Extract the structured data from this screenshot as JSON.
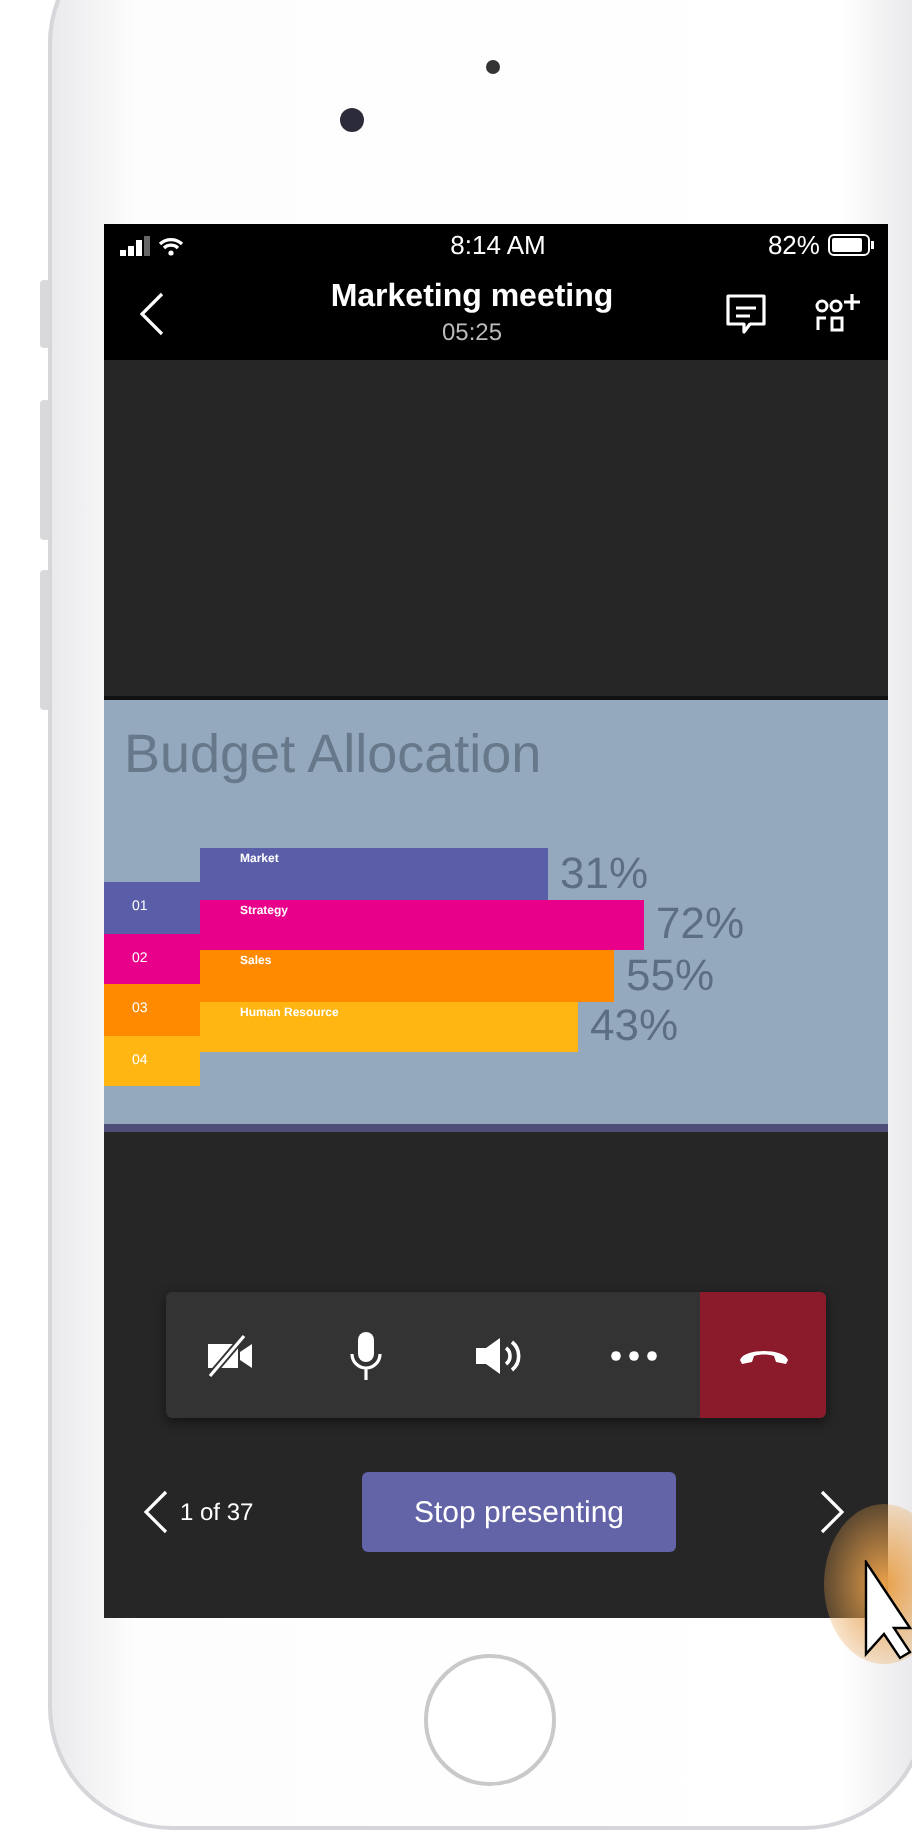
{
  "status_bar": {
    "time": "8:14 AM",
    "battery": "82%"
  },
  "header": {
    "title": "Marketing meeting",
    "duration": "05:25"
  },
  "slide": {
    "title": "Budget Allocation",
    "bars": [
      {
        "tag": "01",
        "label": "Market",
        "percent": "31%",
        "color": "#5a5ea8"
      },
      {
        "tag": "02",
        "label": "Strategy",
        "percent": "72%",
        "color": "#e8008a"
      },
      {
        "tag": "03",
        "label": "Sales",
        "percent": "55%",
        "color": "#ff8a00"
      },
      {
        "tag": "04",
        "label": "Human Resource",
        "percent": "43%",
        "color": "#ffb612"
      }
    ]
  },
  "controls": [
    {
      "kind": "camera",
      "on": false
    },
    {
      "kind": "microphone",
      "on": true
    },
    {
      "kind": "speaker",
      "on": true
    },
    {
      "kind": "more"
    },
    {
      "kind": "end-call"
    }
  ],
  "slide_nav": {
    "counter": "1 of 37",
    "stop_button": "Stop presenting"
  }
}
